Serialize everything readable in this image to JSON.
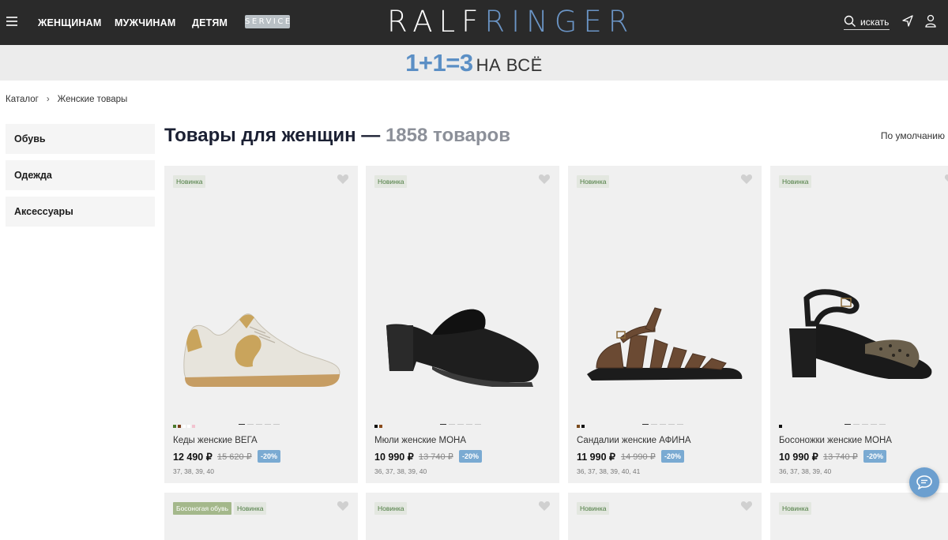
{
  "header": {
    "nav": [
      "ЖЕНЩИНАМ",
      "МУЖЧИНАМ",
      "ДЕТЯМ"
    ],
    "service_label": "SERVICE",
    "logo_left": "RALF",
    "logo_right": "RINGER",
    "search_label": "искать",
    "icons": [
      "menu-icon",
      "search-icon",
      "location-arrow-icon",
      "user-icon"
    ]
  },
  "promo": {
    "big": "1+1=3",
    "small": "НА ВСЁ"
  },
  "breadcrumb": {
    "items": [
      "Каталог",
      "Женские товары"
    ],
    "separator": "›"
  },
  "sidebar": {
    "items": [
      {
        "label": "Обувь"
      },
      {
        "label": "Одежда"
      },
      {
        "label": "Аксессуары"
      }
    ]
  },
  "main": {
    "title": "Товары для женщин —",
    "count": "1858 товаров",
    "sort_label": "По умолчанию"
  },
  "products": [
    {
      "badge": "Новинка",
      "name": "Кеды женские ВЕГА",
      "price": "12 490 ₽",
      "old_price": "15 620 ₽",
      "discount": "-20%",
      "sizes": "37, 38, 39, 40",
      "swatches": [
        "#4c7a2e",
        "#7a3f1a",
        "#ffffff",
        "#ffffff",
        "#f2c3cf"
      ]
    },
    {
      "badge": "Новинка",
      "name": "Мюли женские МОНА",
      "price": "10 990 ₽",
      "old_price": "13 740 ₽",
      "discount": "-20%",
      "sizes": "36, 37, 38, 39, 40",
      "swatches": [
        "#111111",
        "#8a4b1c"
      ]
    },
    {
      "badge": "Новинка",
      "name": "Сандалии женские АФИНА",
      "price": "11 990 ₽",
      "old_price": "14 990 ₽",
      "discount": "-20%",
      "sizes": "36, 37, 38, 39, 40, 41",
      "swatches": [
        "#7a4a1c",
        "#111111"
      ]
    },
    {
      "badge": "Новинка",
      "name": "Босоножки женские МОНА",
      "price": "10 990 ₽",
      "old_price": "13 740 ₽",
      "discount": "-20%",
      "sizes": "36, 37, 38, 39, 40",
      "swatches": [
        "#111111"
      ]
    }
  ],
  "products_row2": [
    {
      "badges": [
        "Босоногая обувь",
        "Новинка"
      ]
    },
    {
      "badges": [
        "Новинка"
      ]
    },
    {
      "badges": [
        "Новинка"
      ]
    },
    {
      "badges": [
        "Новинка"
      ]
    }
  ],
  "colors": {
    "header_bg": "#2a2a2a",
    "accent_blue": "#6b95c6",
    "discount_bg": "#7aaad2",
    "card_bg": "#f0f0f0"
  }
}
